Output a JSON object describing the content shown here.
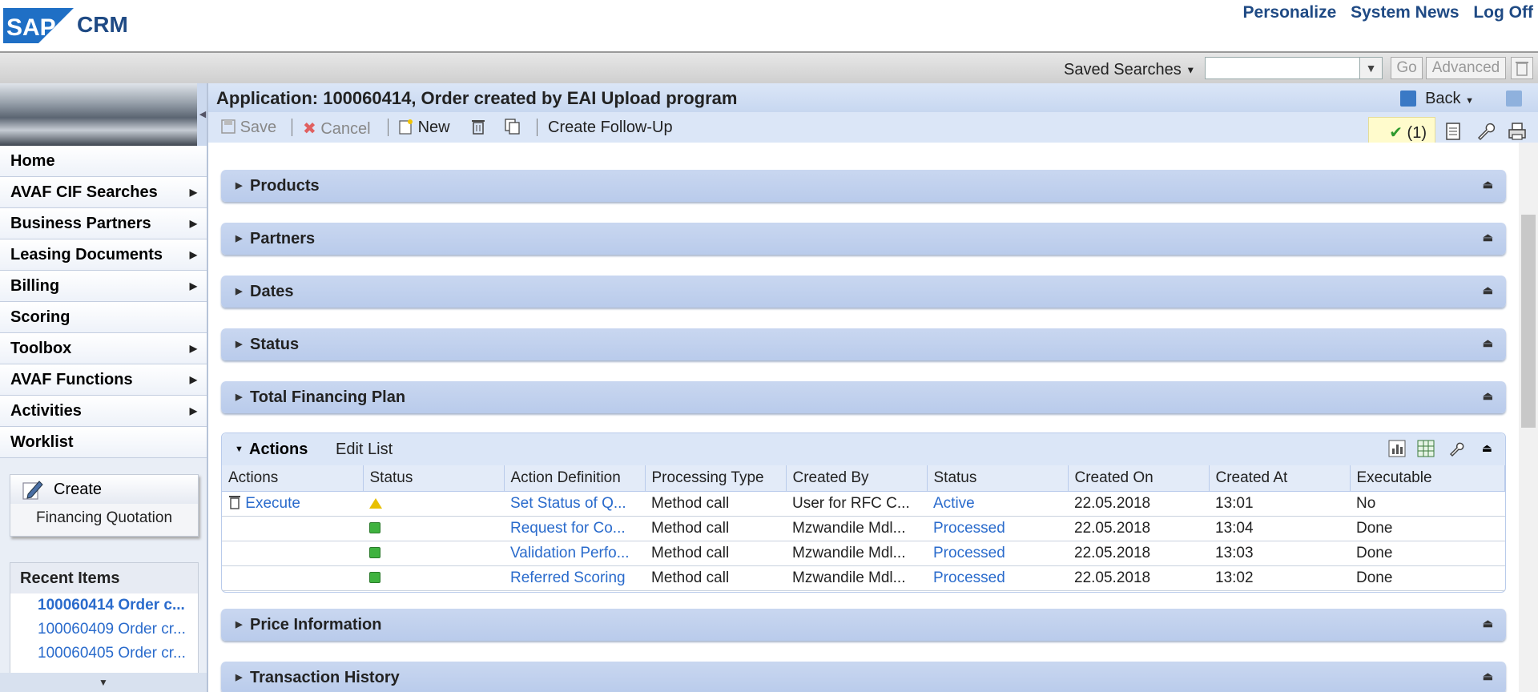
{
  "brand": {
    "sap": "SAP",
    "crm": "CRM"
  },
  "top_links": [
    "Personalize",
    "System News",
    "Log Off"
  ],
  "search": {
    "saved_label": "Saved Searches",
    "input_value": "",
    "go_label": "Go",
    "advanced_label": "Advanced"
  },
  "nav": {
    "items": [
      {
        "label": "Home",
        "arrow": false
      },
      {
        "label": "AVAF CIF Searches",
        "arrow": true
      },
      {
        "label": "Business Partners",
        "arrow": true
      },
      {
        "label": "Leasing Documents",
        "arrow": true
      },
      {
        "label": "Billing",
        "arrow": true
      },
      {
        "label": "Scoring",
        "arrow": false
      },
      {
        "label": "Toolbox",
        "arrow": true
      },
      {
        "label": "AVAF Functions",
        "arrow": true
      },
      {
        "label": "Activities",
        "arrow": true
      },
      {
        "label": "Worklist",
        "arrow": false
      }
    ]
  },
  "create": {
    "title": "Create",
    "item": "Financing Quotation"
  },
  "recent": {
    "title": "Recent Items",
    "items": [
      "100060414 Order c...",
      "100060409 Order cr...",
      "100060405 Order cr..."
    ]
  },
  "header": {
    "title": "Application: 100060414, Order created by EAI Upload program",
    "back_label": "Back"
  },
  "toolbar": {
    "save": "Save",
    "cancel": "Cancel",
    "new": "New",
    "followup": "Create Follow-Up",
    "messages": "(1)"
  },
  "blocks": {
    "products": "Products",
    "partners": "Partners",
    "dates": "Dates",
    "status": "Status",
    "financing": "Total Financing Plan",
    "price": "Price Information",
    "history": "Transaction History"
  },
  "actions": {
    "title": "Actions",
    "edit_list": "Edit List",
    "columns": [
      "Actions",
      "Status",
      "Action Definition",
      "Processing Type",
      "Created By",
      "Status",
      "Created On",
      "Created At",
      "Executable"
    ],
    "rows": [
      {
        "action": "Execute",
        "status_icon": "warning-icon",
        "definition": "Set Status of Q...",
        "type": "Method call",
        "created_by": "User for RFC C...",
        "status": "Active",
        "created_on": "22.05.2018",
        "created_at": "13:01",
        "executable": "No"
      },
      {
        "action": "",
        "status_icon": "green-square-icon",
        "definition": "Request for Co...",
        "type": "Method call",
        "created_by": "Mzwandile Mdl...",
        "status": "Processed",
        "created_on": "22.05.2018",
        "created_at": "13:04",
        "executable": "Done"
      },
      {
        "action": "",
        "status_icon": "green-square-icon",
        "definition": "Validation Perfo...",
        "type": "Method call",
        "created_by": "Mzwandile Mdl...",
        "status": "Processed",
        "created_on": "22.05.2018",
        "created_at": "13:03",
        "executable": "Done"
      },
      {
        "action": "",
        "status_icon": "green-square-icon",
        "definition": "Referred Scoring",
        "type": "Method call",
        "created_by": "Mzwandile Mdl...",
        "status": "Processed",
        "created_on": "22.05.2018",
        "created_at": "13:02",
        "executable": "Done"
      }
    ]
  },
  "colors": {
    "brand_blue": "#1f4a84",
    "link_blue": "#2a6bcc",
    "block_blue": "#c9d7f0"
  }
}
